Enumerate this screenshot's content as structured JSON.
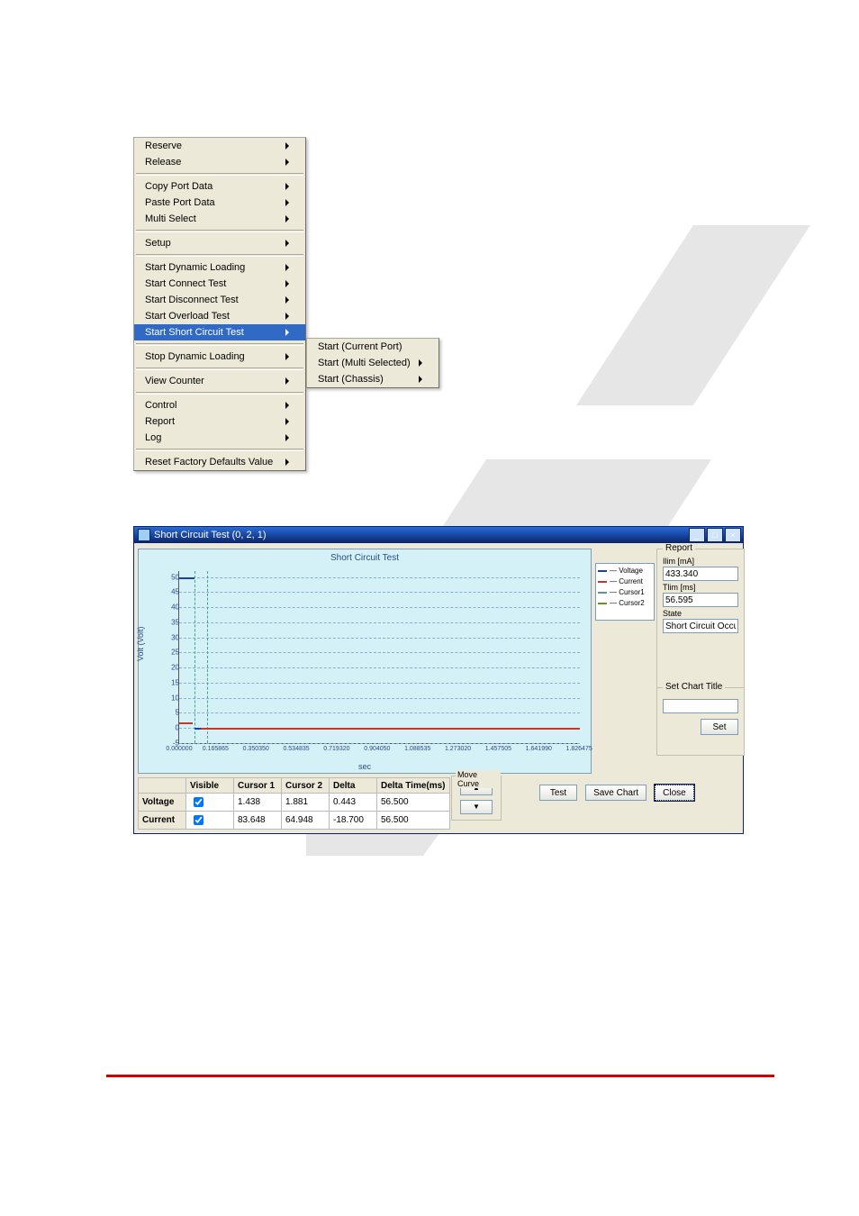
{
  "menu_main": [
    {
      "label": "Reserve",
      "arrow": true
    },
    {
      "label": "Release",
      "arrow": true
    },
    {
      "sep": true
    },
    {
      "label": "Copy Port Data",
      "arrow": true
    },
    {
      "label": "Paste Port Data",
      "arrow": true
    },
    {
      "label": "Multi Select",
      "arrow": true
    },
    {
      "sep": true
    },
    {
      "label": "Setup",
      "arrow": true
    },
    {
      "sep": true
    },
    {
      "label": "Start Dynamic Loading",
      "arrow": true
    },
    {
      "label": "Start Connect Test",
      "arrow": true
    },
    {
      "label": "Start Disconnect Test",
      "arrow": true
    },
    {
      "label": "Start Overload Test",
      "arrow": true
    },
    {
      "label": "Start Short Circuit Test",
      "arrow": true,
      "selected": true
    },
    {
      "sep": true
    },
    {
      "label": "Stop Dynamic Loading",
      "arrow": true
    },
    {
      "sep": true
    },
    {
      "label": "View Counter",
      "arrow": true
    },
    {
      "sep": true
    },
    {
      "label": "Control",
      "arrow": true
    },
    {
      "label": "Report",
      "arrow": true
    },
    {
      "label": "Log",
      "arrow": true
    },
    {
      "sep": true
    },
    {
      "label": "Reset Factory Defaults Value",
      "arrow": true
    }
  ],
  "menu_sub": [
    {
      "label": "Start (Current Port)",
      "arrow": false
    },
    {
      "label": "Start (Multi Selected)",
      "arrow": true
    },
    {
      "label": "Start (Chassis)",
      "arrow": true
    }
  ],
  "win": {
    "title": "Short Circuit Test (0, 2, 1)",
    "chart_title": "Short Circuit Test",
    "ylabel": "Volt (Volt)",
    "xlabel": "sec",
    "legend": [
      "Voltage",
      "Current",
      "Cursor1",
      "Cursor2"
    ],
    "report": {
      "group": "Report",
      "ilim_ma_label": "Ilim [mA]",
      "ilim_ma": "433.340",
      "tlim_ms_label": "Tlim [ms]",
      "tlim_ms": "56.595",
      "state_label": "State",
      "state": "Short Circuit Occurs",
      "set_title_group": "Set Chart Title",
      "set_title_value": "",
      "set_btn": "Set"
    },
    "cursor_table": {
      "headers": [
        "",
        "Visible",
        "Cursor 1",
        "Cursor 2",
        "Delta",
        "Delta Time(ms)"
      ],
      "rows": [
        {
          "name": "Voltage",
          "visible": true,
          "c1": "1.438",
          "c2": "1.881",
          "delta": "0.443",
          "dt": "56.500"
        },
        {
          "name": "Current",
          "visible": true,
          "c1": "83.648",
          "c2": "64.948",
          "delta": "-18.700",
          "dt": "56.500"
        }
      ]
    },
    "move_curve": "Move Curve",
    "buttons": {
      "test": "Test",
      "save": "Save Chart",
      "close": "Close"
    },
    "winbtns": {
      "min": "_",
      "max": "□",
      "close": "×"
    }
  },
  "chart_data": {
    "type": "line",
    "title": "Short Circuit Test",
    "xlabel": "sec",
    "ylabel": "Volt (Volt)",
    "yticks": [
      -5,
      0,
      5,
      10,
      15,
      20,
      25,
      30,
      35,
      40,
      45,
      50
    ],
    "xticks": [
      0.0,
      0.165865,
      0.35035,
      0.534835,
      0.71932,
      0.90405,
      1.088535,
      1.27302,
      1.457505,
      1.64199,
      1.826475
    ],
    "xlim": [
      0,
      1.83
    ],
    "ylim": [
      -5,
      52
    ],
    "cursors_x": [
      0.07,
      0.126
    ],
    "series": [
      {
        "name": "Voltage",
        "color": "#1a3fb0",
        "x": [
          0,
          0.07,
          0.071,
          1.83
        ],
        "y": [
          50,
          50,
          0,
          0
        ]
      },
      {
        "name": "Current",
        "color": "#c0392b",
        "x": [
          0,
          0.06,
          0.07,
          0.072,
          0.1,
          1.83
        ],
        "y": [
          2,
          2,
          84,
          65,
          0,
          0
        ]
      }
    ]
  }
}
